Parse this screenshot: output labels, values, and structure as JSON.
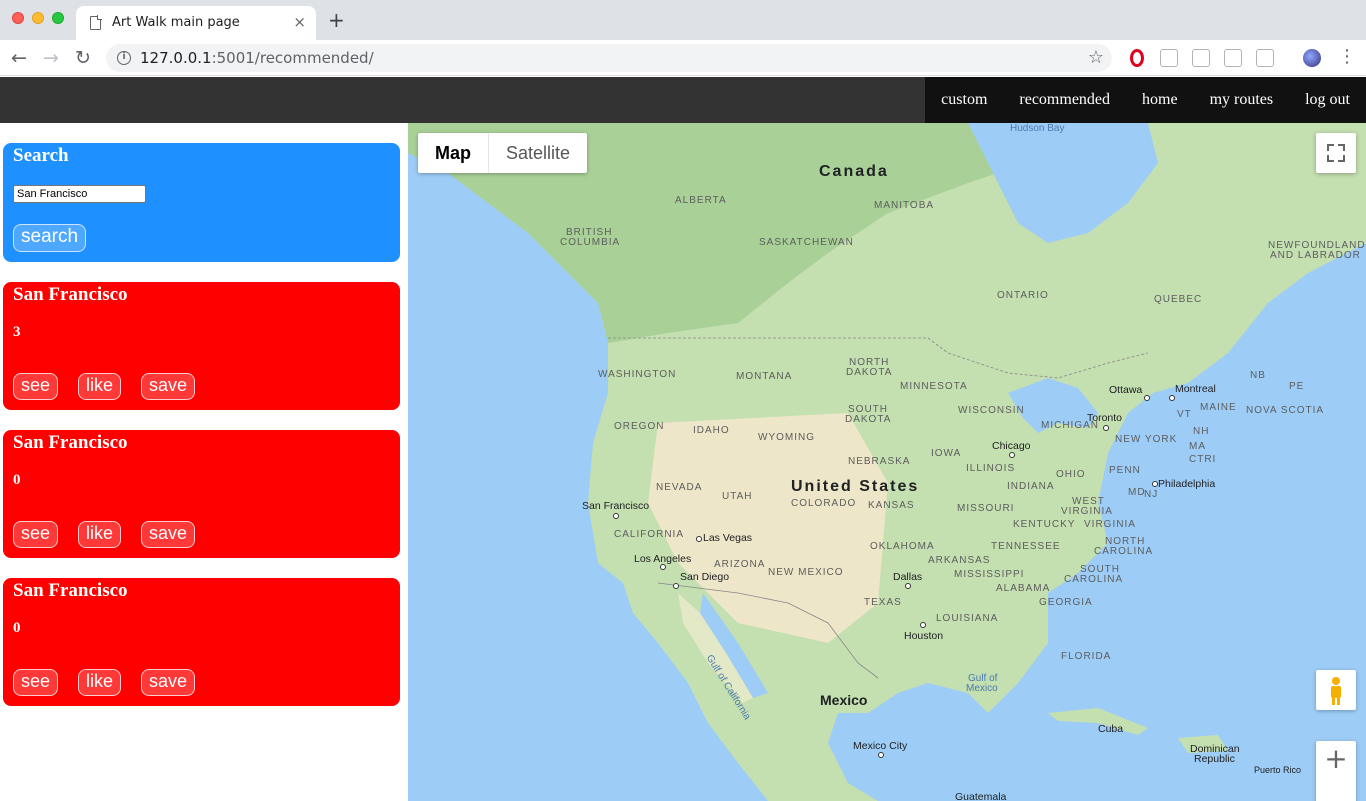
{
  "browser": {
    "tab_title": "Art Walk main page",
    "tab_close": "×",
    "new_tab": "+",
    "url_host": "127.0.0.1",
    "url_path": ":5001/recommended/"
  },
  "nav": {
    "links": [
      "custom",
      "recommended",
      "home",
      "my routes",
      "log out"
    ]
  },
  "search": {
    "title": "Search",
    "value": "San Francisco",
    "button": "search"
  },
  "routes": [
    {
      "title": "San Francisco",
      "count": "3",
      "see": "see",
      "like": "like",
      "save": "save"
    },
    {
      "title": "San Francisco",
      "count": "0",
      "see": "see",
      "like": "like",
      "save": "save"
    },
    {
      "title": "San Francisco",
      "count": "0",
      "see": "see",
      "like": "like",
      "save": "save"
    }
  ],
  "map": {
    "type_buttons": [
      "Map",
      "Satellite"
    ],
    "countries": {
      "canada": "Canada",
      "us": "United States",
      "mexico": "Mexico"
    },
    "water": {
      "hudson": "Hudson Bay",
      "gulf_mexico_1": "Gulf of",
      "gulf_mexico_2": "Mexico",
      "gulf_california": "Gulf of California"
    },
    "regions": {
      "alberta": "ALBERTA",
      "manitoba": "MANITOBA",
      "bc1": "BRITISH",
      "bc2": "COLUMBIA",
      "saskatchewan": "SASKATCHEWAN",
      "ontario": "ONTARIO",
      "quebec": "QUEBEC",
      "nl1": "NEWFOUNDLAND",
      "nl2": "AND LABRADOR",
      "nb": "NB",
      "pe": "PE",
      "nova_scotia": "NOVA SCOTIA",
      "washington": "WASHINGTON",
      "montana": "MONTANA",
      "north_dakota1": "NORTH",
      "north_dakota2": "DAKOTA",
      "minnesota": "MINNESOTA",
      "south_dakota1": "SOUTH",
      "south_dakota2": "DAKOTA",
      "wisconsin": "WISCONSIN",
      "michigan": "MICHIGAN",
      "oregon": "OREGON",
      "idaho": "IDAHO",
      "wyoming": "WYOMING",
      "iowa": "IOWA",
      "nebraska": "NEBRASKA",
      "illinois": "ILLINOIS",
      "ohio": "OHIO",
      "penn": "PENN",
      "new_york": "NEW YORK",
      "vt": "VT",
      "nh": "NH",
      "maine": "MAINE",
      "ma": "MA",
      "ctri": "CTRI",
      "md": "MD",
      "nj": "NJ",
      "nevada": "NEVADA",
      "utah": "UTAH",
      "colorado": "COLORADO",
      "kansas": "KANSAS",
      "missouri": "MISSOURI",
      "indiana": "INDIANA",
      "west_virginia1": "WEST",
      "west_virginia2": "VIRGINIA",
      "virginia": "VIRGINIA",
      "kentucky": "KENTUCKY",
      "california": "CALIFORNIA",
      "tennessee": "TENNESSEE",
      "north_carolina1": "NORTH",
      "north_carolina2": "CAROLINA",
      "arizona": "ARIZONA",
      "oklahoma": "OKLAHOMA",
      "new_mexico": "NEW MEXICO",
      "arkansas": "ARKANSAS",
      "mississippi": "MISSISSIPPI",
      "south_carolina1": "SOUTH",
      "south_carolina2": "CAROLINA",
      "alabama": "ALABAMA",
      "georgia": "GEORGIA",
      "texas": "TEXAS",
      "louisiana": "LOUISIANA",
      "florida": "FLORIDA"
    },
    "cities": {
      "ottawa": "Ottawa",
      "montreal": "Montreal",
      "toronto": "Toronto",
      "chicago": "Chicago",
      "philadelphia": "Philadelphia",
      "san_francisco": "San Francisco",
      "las_vegas": "Las Vegas",
      "los_angeles": "Los Angeles",
      "san_diego": "San Diego",
      "dallas": "Dallas",
      "houston": "Houston",
      "mexico_city": "Mexico City",
      "cuba": "Cuba",
      "dominican1": "Dominican",
      "dominican2": "Republic",
      "puerto_rico": "Puerto Rico",
      "guatemala": "Guatemala"
    },
    "zoom_in": "+"
  }
}
